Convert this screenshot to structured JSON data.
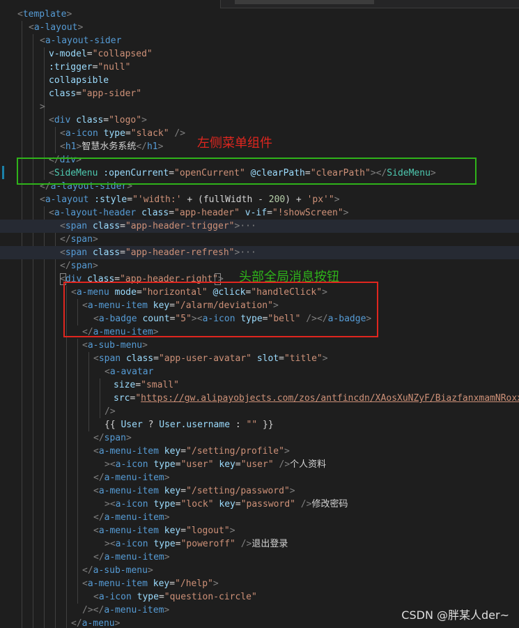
{
  "annotations": {
    "left_menu_component": "左侧菜单组件",
    "header_global_message_button": "头部全局消息按钮"
  },
  "watermark": "CSDN @胖某人der~",
  "code": {
    "l1": {
      "tag_open": "<",
      "tag": "template",
      "tag_close": ">"
    },
    "l2": {
      "tag_open": "<",
      "tag": "a-layout",
      "tag_close": ">"
    },
    "l3": {
      "tag_open": "<",
      "tag": "a-layout-sider"
    },
    "l4": {
      "attr": "v-model",
      "eq": "=",
      "val": "\"collapsed\""
    },
    "l5": {
      "attr": ":trigger",
      "eq": "=",
      "val": "\"null\""
    },
    "l6": {
      "attr": "collapsible"
    },
    "l7": {
      "attr": "class",
      "eq": "=",
      "val": "\"app-sider\""
    },
    "l8": {
      "tag_close": ">"
    },
    "l9": {
      "tag_open": "<",
      "tag": "div",
      "attr": "class",
      "eq": "=",
      "val": "\"logo\"",
      "tag_close": ">"
    },
    "l10": {
      "tag_open": "<",
      "tag": "a-icon",
      "attr": "type",
      "eq": "=",
      "val": "\"slack\"",
      "self_close": " />"
    },
    "l11": {
      "tag_open": "<",
      "tag": "h1",
      "tag_close": ">",
      "text": "智慧水务系统",
      "end_open": "</",
      "end_tag": "h1",
      "end_close": ">"
    },
    "l12": {
      "end_open": "</",
      "end_tag": "div",
      "end_close": ">"
    },
    "l13": {
      "tag_open": "<",
      "cmp": "SideMenu",
      "attr1": ":openCurrent",
      "eq": "=",
      "val1": "\"openCurrent\"",
      "attr2": "@clearPath",
      "val2": "\"clearPath\"",
      "mid": "></",
      "end_cmp": "SideMenu",
      "end_close": ">"
    },
    "l14": {
      "end_open": "</",
      "end_tag": "a-layout-sider",
      "end_close": ">"
    },
    "l15": {
      "tag_open": "<",
      "tag": "a-layout",
      "attr": ":style",
      "eq": "=",
      "q": "\"",
      "s1": "'width:'",
      "plus1": " + (fullWidth - ",
      "num": "200",
      "plus2": ") + ",
      "s2": "'px'",
      "q2": "\"",
      "tag_close": ">"
    },
    "l16": {
      "tag_open": "<",
      "tag": "a-layout-header",
      "attr1": "class",
      "eq": "=",
      "val1": "\"app-header\"",
      "attr2": "v-if",
      "val2": "\"!showScreen\"",
      "tag_close": ">"
    },
    "l17": {
      "tag_open": "<",
      "tag": "span",
      "attr": "class",
      "eq": "=",
      "val": "\"app-header-trigger\"",
      "tag_close": ">",
      "ellipsis": "···"
    },
    "l18": {
      "end_open": "</",
      "end_tag": "span",
      "end_close": ">"
    },
    "l19": {
      "tag_open": "<",
      "tag": "span",
      "attr": "class",
      "eq": "=",
      "val": "\"app-header-refresh\"",
      "tag_close": ">",
      "ellipsis": "···"
    },
    "l20": {
      "end_open": "</",
      "end_tag": "span",
      "end_close": ">"
    },
    "l21": {
      "tag_open": "<",
      "tag": "div",
      "attr": "class",
      "eq": "=",
      "val": "\"app-header-right\"",
      "tag_close": ">"
    },
    "l22": {
      "tag_open": "<",
      "tag": "a-menu",
      "attr1": "mode",
      "eq": "=",
      "val1": "\"horizontal\"",
      "attr2": "@click",
      "val2": "\"handleClick\"",
      "tag_close": ">"
    },
    "l23": {
      "tag_open": "<",
      "tag": "a-menu-item",
      "attr": "key",
      "eq": "=",
      "val": "\"/alarm/deviation\"",
      "tag_close": ">"
    },
    "l24": {
      "tag_open": "<",
      "tag": "a-badge",
      "attr": "count",
      "eq": "=",
      "val": "\"5\"",
      "mid": "><",
      "tag2": "a-icon",
      "attr2": "type",
      "val2": "\"bell\"",
      "mid2": " /></",
      "end_tag": "a-badge",
      "end_close": ">"
    },
    "l25": {
      "end_open": "</",
      "end_tag": "a-menu-item",
      "end_close": ">"
    },
    "l26": {
      "tag_open": "<",
      "tag": "a-sub-menu",
      "tag_close": ">"
    },
    "l27": {
      "tag_open": "<",
      "tag": "span",
      "attr1": "class",
      "eq": "=",
      "val1": "\"app-user-avatar\"",
      "attr2": "slot",
      "val2": "\"title\"",
      "tag_close": ">"
    },
    "l28": {
      "tag_open": "<",
      "tag": "a-avatar"
    },
    "l29": {
      "attr": "size",
      "eq": "=",
      "val": "\"small\""
    },
    "l30": {
      "attr": "src",
      "eq": "=",
      "q": "\"",
      "url": "https://gw.alipayobjects.com/zos/antfincdn/XAosXuNZyF/BiazfanxmamNRoxxV"
    },
    "l31": {
      "self_close": "/>"
    },
    "l32": {
      "open": "{{ ",
      "ident1": "User",
      "op1": " ? ",
      "ident2": "User.username",
      "op2": " : ",
      "str": "\"\"",
      "close": " }}"
    },
    "l33": {
      "end_open": "</",
      "end_tag": "span",
      "end_close": ">"
    },
    "l34": {
      "tag_open": "<",
      "tag": "a-menu-item",
      "attr": "key",
      "eq": "=",
      "val": "\"/setting/profile\"",
      "tag_close": ">"
    },
    "l35": {
      "lead": "><",
      "tag": "a-icon",
      "attr1": "type",
      "eq": "=",
      "val1": "\"user\"",
      "attr2": "key",
      "val2": "\"user\"",
      "self_close": " />",
      "text": "个人资料"
    },
    "l36": {
      "end_open": "</",
      "end_tag": "a-menu-item",
      "end_close": ">"
    },
    "l37": {
      "tag_open": "<",
      "tag": "a-menu-item",
      "attr": "key",
      "eq": "=",
      "val": "\"/setting/password\"",
      "tag_close": ">"
    },
    "l38": {
      "lead": "><",
      "tag": "a-icon",
      "attr1": "type",
      "eq": "=",
      "val1": "\"lock\"",
      "attr2": "key",
      "val2": "\"password\"",
      "self_close": " />",
      "text": "修改密码"
    },
    "l39": {
      "end_open": "</",
      "end_tag": "a-menu-item",
      "end_close": ">"
    },
    "l40": {
      "tag_open": "<",
      "tag": "a-menu-item",
      "attr": "key",
      "eq": "=",
      "val": "\"logout\"",
      "tag_close": ">"
    },
    "l41": {
      "lead": "><",
      "tag": "a-icon",
      "attr": "type",
      "eq": "=",
      "val": "\"poweroff\"",
      "self_close": " />",
      "text": "退出登录"
    },
    "l42": {
      "end_open": "</",
      "end_tag": "a-menu-item",
      "end_close": ">"
    },
    "l43": {
      "end_open": "</",
      "end_tag": "a-sub-menu",
      "end_close": ">"
    },
    "l44": {
      "tag_open": "<",
      "tag": "a-menu-item",
      "attr": "key",
      "eq": "=",
      "val": "\"/help\"",
      "tag_close": ">"
    },
    "l45": {
      "tag_open": "<",
      "tag": "a-icon",
      "attr": "type",
      "eq": "=",
      "val": "\"question-circle\""
    },
    "l46": {
      "lead": "/></",
      "end_tag": "a-menu-item",
      "end_close": ">"
    },
    "l47": {
      "end_open": "</",
      "end_tag": "a-menu",
      "end_close": ">"
    }
  }
}
